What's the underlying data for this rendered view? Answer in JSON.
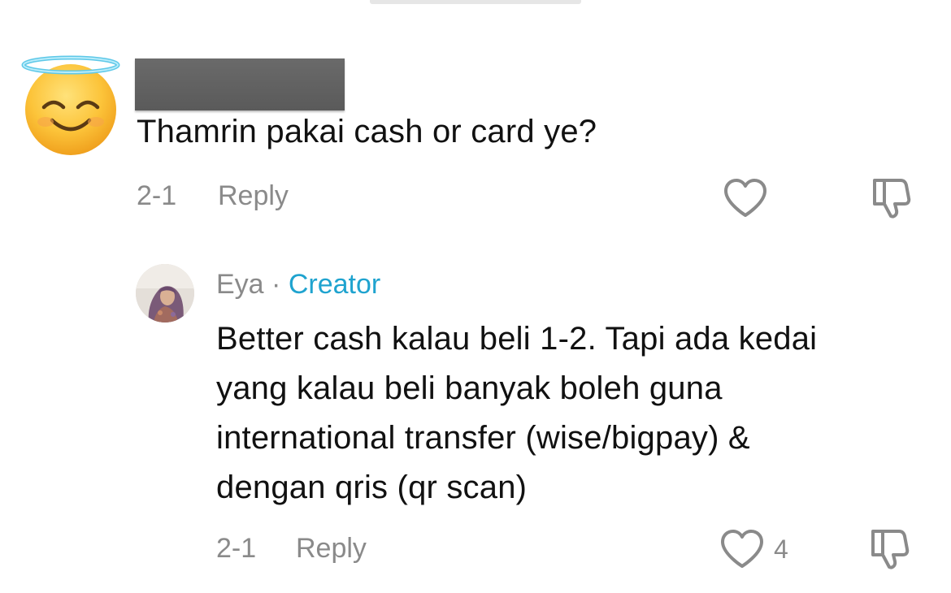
{
  "comment": {
    "text": "Thamrin pakai cash or card ye?",
    "date": "2-1",
    "reply_label": "Reply",
    "avatar_icon": "smiling-face-with-halo-emoji",
    "like_icon": "heart-outline-icon",
    "dislike_icon": "thumbs-down-icon"
  },
  "reply": {
    "author": "Eya",
    "separator": "·",
    "badge": "Creator",
    "lines": [
      "Better cash kalau beli 1-2. Tapi ada kedai",
      "yang kalau beli banyak boleh guna",
      "international transfer (wise/bigpay) &",
      "dengan qris (qr scan)"
    ],
    "date": "2-1",
    "reply_label": "Reply",
    "like_count": "4",
    "like_icon": "heart-outline-icon",
    "dislike_icon": "thumbs-down-icon"
  },
  "colors": {
    "creator_badge": "#1fa3cf",
    "meta_text": "#8a8a8a",
    "body_text": "#111111"
  }
}
